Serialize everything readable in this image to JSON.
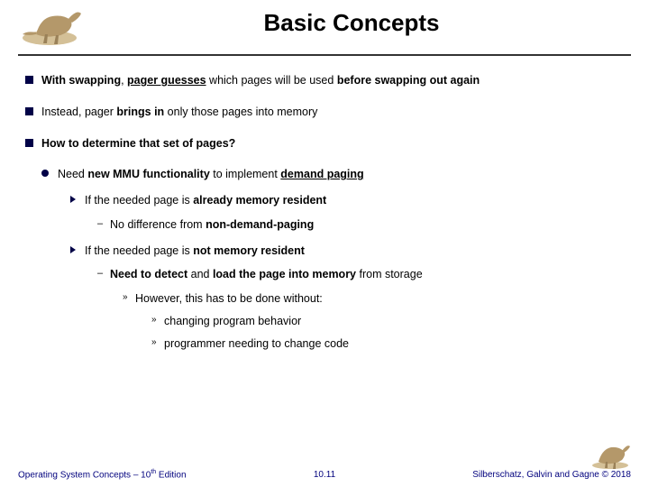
{
  "title": "Basic Concepts",
  "bullets": {
    "b1_pre": "With swapping",
    "b1_mid": "pager guesses",
    "b1_post": " which pages will be used ",
    "b1_bold2": "before swapping out again",
    "b2_pre": "Instead, pager ",
    "b2_bold": "brings in",
    "b2_post": " only those pages into memory",
    "b3": "How to determine that set of pages?",
    "b3_1_pre": "Need ",
    "b3_1_bold": "new MMU functionality",
    "b3_1_mid": " to implement ",
    "b3_1_u": "demand paging",
    "b3_1_1_pre": "If the needed page is ",
    "b3_1_1_bold": "already memory resident",
    "b3_1_1_1_pre": "No difference from ",
    "b3_1_1_1_bold": "non-demand-paging",
    "b3_1_2_pre": "If the needed page is ",
    "b3_1_2_bold": "not memory resident",
    "b3_1_2_1_pre": "Need to ",
    "b3_1_2_1_b1": "detect",
    "b3_1_2_1_mid": " and ",
    "b3_1_2_1_b2": "load the page into memory",
    "b3_1_2_1_post": " from storage",
    "b3_1_2_1_1": "However, this has to be done without:",
    "b3_1_2_1_1_1": "changing program behavior",
    "b3_1_2_1_1_2": "programmer needing to change code"
  },
  "footer": {
    "left_pre": "Operating System Concepts – 10",
    "left_sup": "th",
    "left_post": " Edition",
    "center": "10.11",
    "right": "Silberschatz, Galvin and Gagne © 2018"
  }
}
